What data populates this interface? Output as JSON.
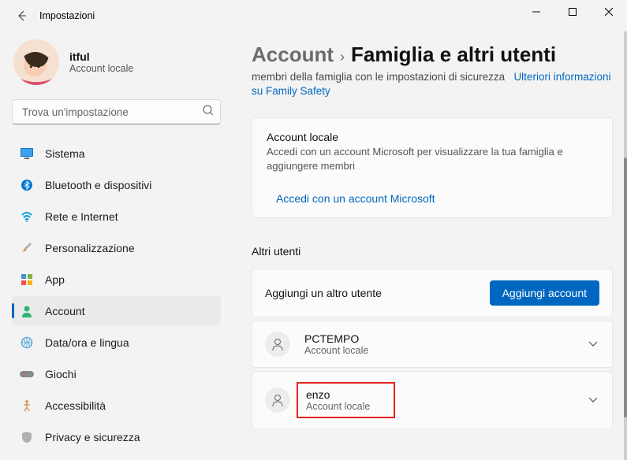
{
  "window": {
    "title": "Impostazioni"
  },
  "user": {
    "name": "itful",
    "type": "Account locale"
  },
  "search": {
    "placeholder": "Trova un'impostazione"
  },
  "nav": {
    "items": [
      {
        "label": "Sistema"
      },
      {
        "label": "Bluetooth e dispositivi"
      },
      {
        "label": "Rete e Internet"
      },
      {
        "label": "Personalizzazione"
      },
      {
        "label": "App"
      },
      {
        "label": "Account"
      },
      {
        "label": "Data/ora e lingua"
      },
      {
        "label": "Giochi"
      },
      {
        "label": "Accessibilità"
      },
      {
        "label": "Privacy e sicurezza"
      }
    ]
  },
  "breadcrumb": {
    "parent": "Account",
    "current": "Famiglia e altri utenti"
  },
  "family": {
    "desc": "membri della famiglia con le impostazioni di sicurezza",
    "link": "Ulteriori informazioni su Family Safety"
  },
  "local_card": {
    "title": "Account locale",
    "sub": "Accedi con un account Microsoft per visualizzare la tua famiglia e aggiungere membri",
    "link": "Accedi con un account Microsoft"
  },
  "other_users": {
    "title": "Altri utenti",
    "add_label": "Aggiungi un altro utente",
    "add_button": "Aggiungi account",
    "list": [
      {
        "name": "PCTEMPO",
        "type": "Account locale"
      },
      {
        "name": "enzo",
        "type": "Account locale"
      }
    ]
  }
}
